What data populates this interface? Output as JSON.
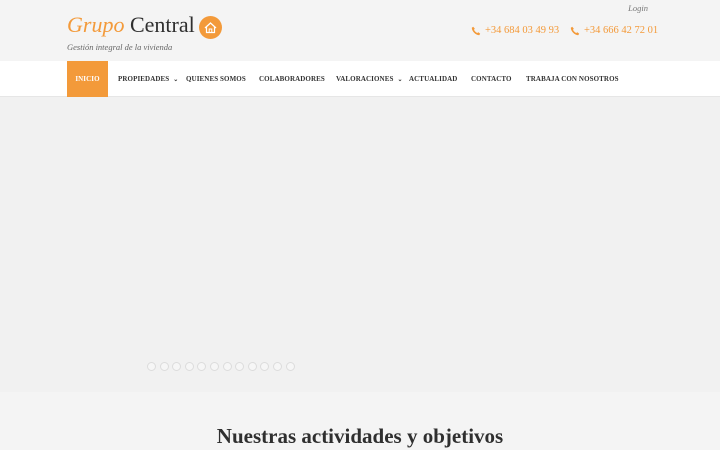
{
  "header": {
    "brand_word_1": "Grupo",
    "brand_word_2": "Central",
    "tagline": "Gestión integral de la vivienda",
    "login": "Login",
    "phones": [
      "+34 684 03 49 93",
      "+34 666 42 72 01"
    ]
  },
  "nav": {
    "items": [
      {
        "label": "INICIO",
        "active": true
      },
      {
        "label": "PROPIEDADES",
        "has_dropdown": true
      },
      {
        "label": "QUIENES SOMOS"
      },
      {
        "label": "COLABORADORES"
      },
      {
        "label": "VALORACIONES",
        "has_dropdown": true
      },
      {
        "label": "ACTUALIDAD"
      },
      {
        "label": "CONTACTO"
      },
      {
        "label": "TRABAJA CON NOSOTROS"
      }
    ]
  },
  "slider": {
    "slide_count": 12
  },
  "main": {
    "section_title": "Nuestras actividades y objetivos"
  },
  "colors": {
    "accent": "#f39a3a",
    "background": "#f4f4f4",
    "nav_background": "#ffffff"
  },
  "icons": {
    "logo": "house-icon",
    "phone": "phone-icon",
    "dropdown": "chevron-down-icon"
  }
}
